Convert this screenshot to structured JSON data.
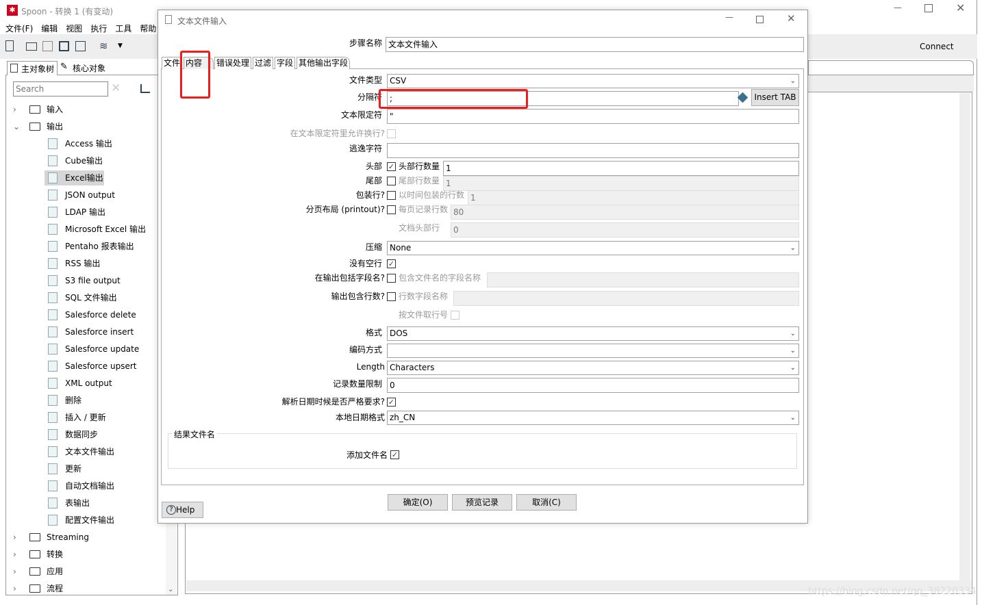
{
  "app": {
    "title": "Spoon - 转换 1 (有变动)",
    "menu": [
      "文件(F)",
      "编辑",
      "视图",
      "执行",
      "工具",
      "帮助"
    ],
    "connect": "Connect",
    "left_tabs": [
      "主对象树",
      "核心对象"
    ],
    "search_placeholder": "Search",
    "tree": {
      "folders_top": [
        "输入",
        "输出"
      ],
      "output_items": [
        "Access 输出",
        "Cube输出",
        "Excel输出",
        "JSON output",
        "LDAP 输出",
        "Microsoft Excel 输出",
        "Pentaho 报表输出",
        "RSS 输出",
        "S3 file output",
        "SQL 文件输出",
        "Salesforce delete",
        "Salesforce insert",
        "Salesforce update",
        "Salesforce upsert",
        "XML output",
        "删除",
        "插入 / 更新",
        "数据同步",
        "文本文件输出",
        "更新",
        "自动文档输出",
        "表输出",
        "配置文件输出"
      ],
      "folders_bottom": [
        "Streaming",
        "转换",
        "应用",
        "流程"
      ],
      "selected": "Excel输出"
    },
    "watermark": "https://blog.csdn.net/qq_38220334"
  },
  "dialog": {
    "title": "文本文件输入",
    "step_name_label": "步骤名称",
    "step_name": "文本文件输入",
    "tabs": [
      "文件",
      "内容",
      "错误处理",
      "过滤",
      "字段",
      "其他输出字段"
    ],
    "active_tab": "内容",
    "fields": {
      "file_type": {
        "label": "文件类型",
        "value": "CSV"
      },
      "separator": {
        "label": "分隔符",
        "value": ";",
        "insert_tab": "Insert TAB"
      },
      "enclosure": {
        "label": "文本限定符",
        "value": "\""
      },
      "allow_breaks": {
        "label": "在文本限定符里允许换行?",
        "checked": false
      },
      "escape": {
        "label": "逃逸字符",
        "value": ""
      },
      "header": {
        "label": "头部",
        "checked": true,
        "sub_label": "头部行数量",
        "value": "1"
      },
      "footer": {
        "label": "尾部",
        "checked": false,
        "sub_label": "尾部行数量",
        "value": "1"
      },
      "wrap": {
        "label": "包装行?",
        "checked": false,
        "sub_label": "以时间包装的行数",
        "value": "1"
      },
      "paged": {
        "label": "分页布局 (printout)?",
        "checked": false,
        "sub_label": "每页记录行数",
        "value": "80"
      },
      "doc_header": {
        "sub_label": "文档头部行",
        "value": "0"
      },
      "compression": {
        "label": "压缩",
        "value": "None"
      },
      "no_empty": {
        "label": "没有空行",
        "checked": true
      },
      "include_filename": {
        "label": "在输出包括字段名?",
        "checked": false,
        "sub_label": "包含文件名的字段名称",
        "value": ""
      },
      "include_rownum": {
        "label": "输出包含行数?",
        "checked": false,
        "sub_label": "行数字段名称",
        "value": ""
      },
      "rownum_by_file": {
        "sub_label": "按文件取行号",
        "checked": false
      },
      "format": {
        "label": "格式",
        "value": "DOS"
      },
      "encoding": {
        "label": "编码方式",
        "value": ""
      },
      "length": {
        "label": "Length",
        "value": "Characters"
      },
      "limit": {
        "label": "记录数量限制",
        "value": "0"
      },
      "lenient_date": {
        "label": "解析日期时候是否严格要求?",
        "checked": true
      },
      "locale": {
        "label": "本地日期格式",
        "value": "zh_CN"
      }
    },
    "result_group": {
      "title": "结果文件名",
      "add_filename": "添加文件名",
      "checked": true
    },
    "buttons": {
      "ok": "确定(O)",
      "preview": "预览记录",
      "cancel": "取消(C)",
      "help": "Help"
    }
  },
  "colors": {
    "annotation": "#f01c1c",
    "logo": "#d0021b"
  }
}
